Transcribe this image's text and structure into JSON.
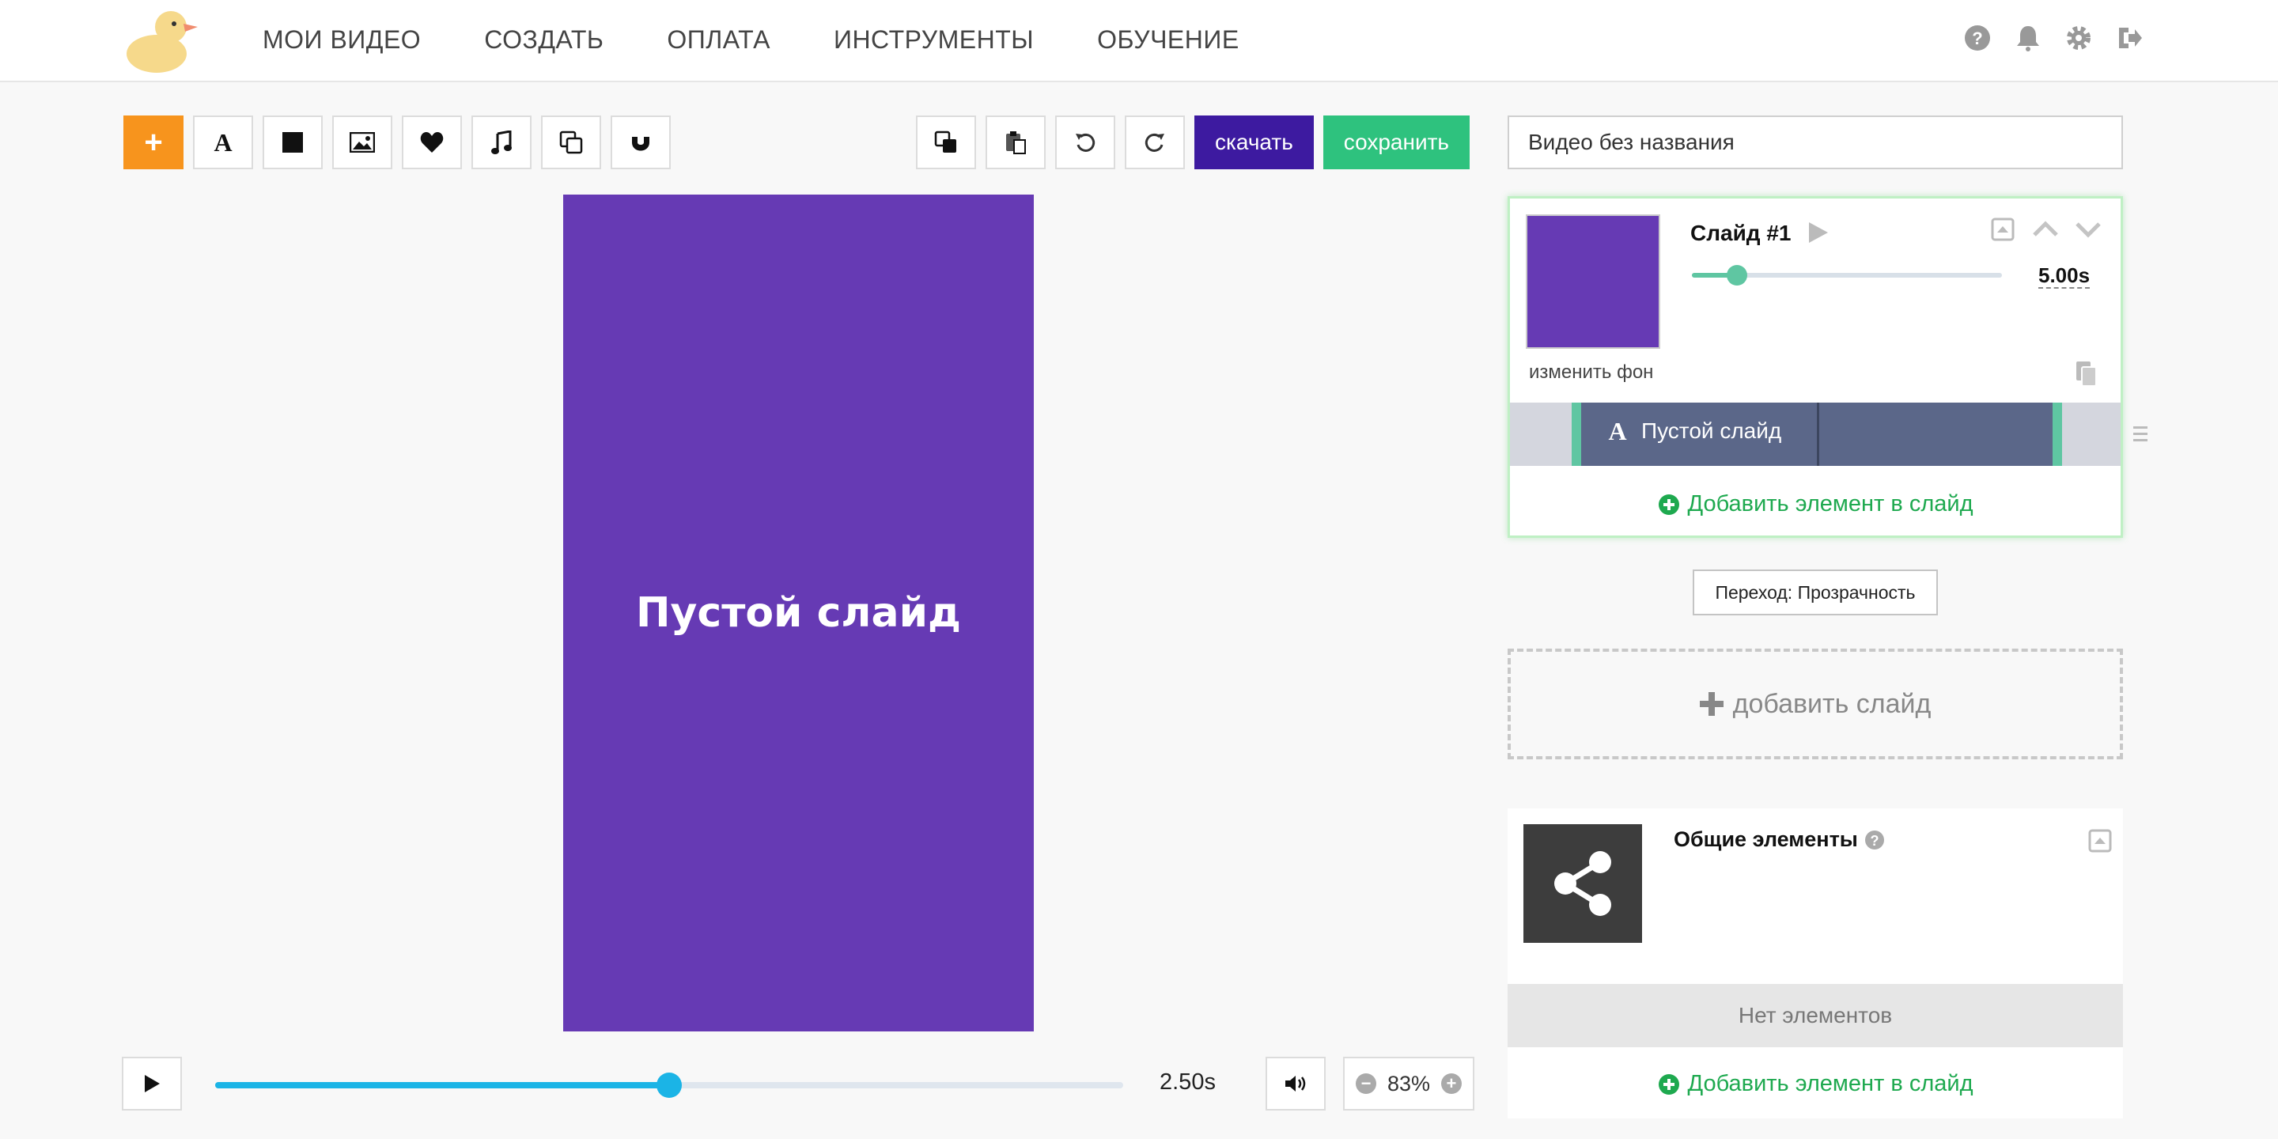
{
  "nav": {
    "items": [
      "МОИ ВИДЕО",
      "СОЗДАТЬ",
      "ОПЛАТА",
      "ИНСТРУМЕНТЫ",
      "ОБУЧЕНИЕ"
    ]
  },
  "toolbar": {
    "download_label": "скачать",
    "save_label": "сохранить"
  },
  "canvas": {
    "text": "Пустой слайд",
    "background": "#663ab4"
  },
  "player": {
    "time": "2.50s",
    "progress": 0.5,
    "zoom": "83%"
  },
  "project": {
    "title": "Видео без названия"
  },
  "slide": {
    "title": "Слайд #1",
    "duration": "5.00s",
    "change_bg_label": "изменить фон",
    "timeline_item": "Пустой слайд",
    "add_element_label": "Добавить элемент в слайд"
  },
  "transition": {
    "label": "Переход: Прозрачность"
  },
  "add_slide": {
    "label": "добавить слайд"
  },
  "common": {
    "title": "Общие элементы",
    "empty_label": "Нет элементов",
    "add_element_label": "Добавить элемент в слайд"
  },
  "colors": {
    "accent_orange": "#f7941d",
    "download": "#3d1aa0",
    "save": "#2ec27e",
    "progress": "#1bb4e6",
    "link_green": "#1ea94f"
  }
}
